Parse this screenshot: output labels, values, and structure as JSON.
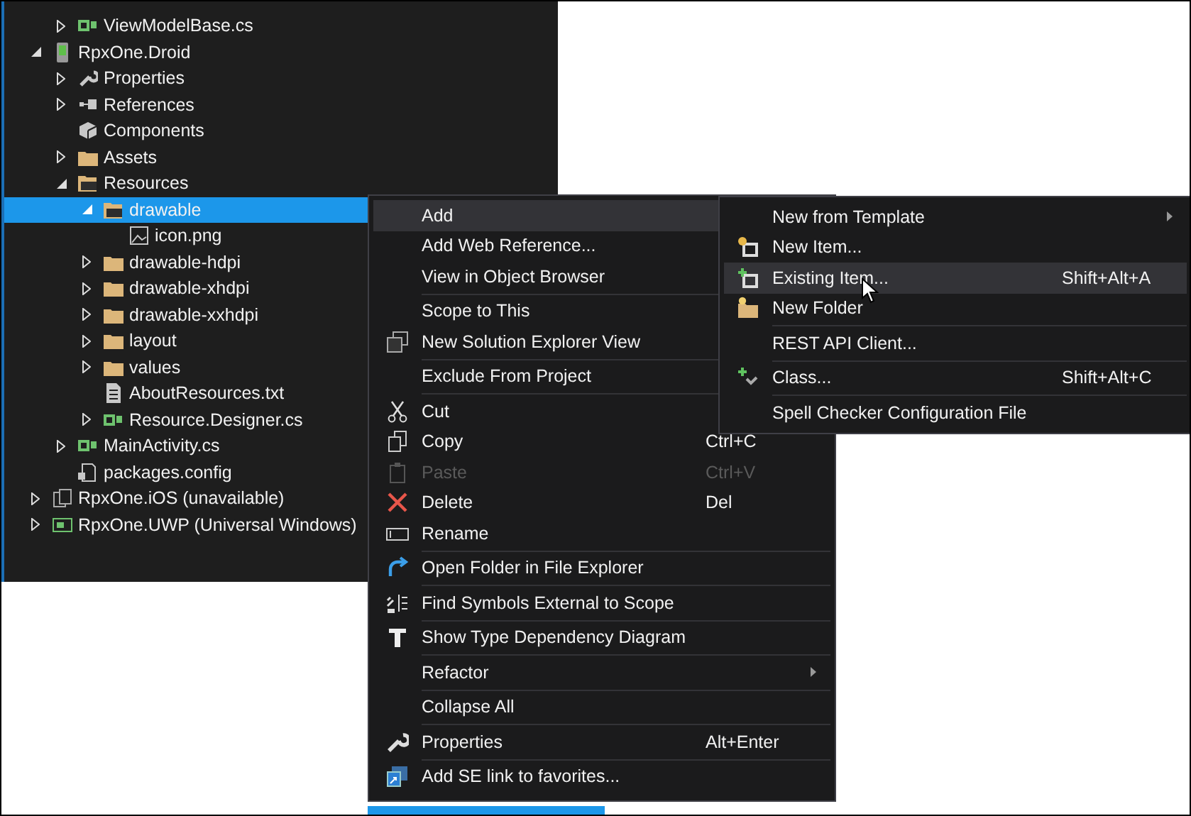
{
  "tree": {
    "cut_off_items": [
      {
        "label": "ViewModelBase.cs",
        "kind": "csharp",
        "expanded": false,
        "selected": false
      }
    ],
    "items": [
      {
        "label": "RpxOne.Droid",
        "kind": "android",
        "expanded": true,
        "selected": false,
        "children": [
          {
            "label": "Properties",
            "kind": "wrench",
            "expanded": false,
            "selected": false
          },
          {
            "label": "References",
            "kind": "references",
            "expanded": false,
            "selected": false
          },
          {
            "label": "Components",
            "kind": "component",
            "selected": false
          },
          {
            "label": "Assets",
            "kind": "folder",
            "expanded": false,
            "selected": false
          },
          {
            "label": "Resources",
            "kind": "folder",
            "expanded": true,
            "selected": false,
            "children": [
              {
                "label": "drawable",
                "kind": "folder",
                "expanded": true,
                "selected": true,
                "children": [
                  {
                    "label": "icon.png",
                    "kind": "image",
                    "selected": false
                  }
                ]
              },
              {
                "label": "drawable-hdpi",
                "kind": "folder",
                "expanded": false,
                "selected": false
              },
              {
                "label": "drawable-xhdpi",
                "kind": "folder",
                "expanded": false,
                "selected": false
              },
              {
                "label": "drawable-xxhdpi",
                "kind": "folder",
                "expanded": false,
                "selected": false
              },
              {
                "label": "layout",
                "kind": "folder",
                "expanded": false,
                "selected": false
              },
              {
                "label": "values",
                "kind": "folder",
                "expanded": false,
                "selected": false
              },
              {
                "label": "AboutResources.txt",
                "kind": "textfile",
                "selected": false
              },
              {
                "label": "Resource.Designer.cs",
                "kind": "csharp",
                "expanded": false,
                "selected": false
              }
            ]
          },
          {
            "label": "MainActivity.cs",
            "kind": "csharp",
            "expanded": false,
            "selected": false
          },
          {
            "label": "packages.config",
            "kind": "config",
            "selected": false
          }
        ]
      },
      {
        "label": "RpxOne.iOS (unavailable)",
        "kind": "ios",
        "expanded": false,
        "selected": false
      },
      {
        "label": "RpxOne.UWP (Universal Windows)",
        "kind": "uwp",
        "expanded": false,
        "selected": false
      }
    ]
  },
  "context_menu": [
    {
      "kind": "plain",
      "label": "Add",
      "highlighted": true,
      "submenu": true
    },
    {
      "kind": "plain",
      "label": "Add Web Reference..."
    },
    {
      "kind": "plain",
      "label": "View in Object Browser"
    },
    {
      "kind": "separator"
    },
    {
      "kind": "plain",
      "label": "Scope to This"
    },
    {
      "kind": "windows",
      "label": "New Solution Explorer View"
    },
    {
      "kind": "separator"
    },
    {
      "kind": "plain",
      "label": "Exclude From Project"
    },
    {
      "kind": "separator"
    },
    {
      "kind": "scissors",
      "label": "Cut"
    },
    {
      "kind": "copy",
      "label": "Copy",
      "shortcut": "Ctrl+C"
    },
    {
      "kind": "paste",
      "label": "Paste",
      "shortcut": "Ctrl+V",
      "disabled": true
    },
    {
      "kind": "delete",
      "label": "Delete",
      "shortcut": "Del"
    },
    {
      "kind": "rename",
      "label": "Rename"
    },
    {
      "kind": "separator"
    },
    {
      "kind": "openfolder",
      "label": "Open Folder in File Explorer"
    },
    {
      "kind": "separator"
    },
    {
      "kind": "symbols",
      "label": "Find Symbols External to Scope"
    },
    {
      "kind": "separator"
    },
    {
      "kind": "type",
      "label": "Show Type Dependency Diagram"
    },
    {
      "kind": "separator"
    },
    {
      "kind": "plain",
      "label": "Refactor",
      "submenu": true
    },
    {
      "kind": "separator"
    },
    {
      "kind": "plain",
      "label": "Collapse All"
    },
    {
      "kind": "separator"
    },
    {
      "kind": "wrench",
      "label": "Properties",
      "shortcut": "Alt+Enter"
    },
    {
      "kind": "separator"
    },
    {
      "kind": "link",
      "label": "Add SE link to favorites..."
    }
  ],
  "add_submenu": [
    {
      "kind": "plain",
      "label": "New from Template",
      "submenu": true
    },
    {
      "kind": "newitem",
      "label": "New Item..."
    },
    {
      "kind": "existingitem",
      "label": "Existing Item...",
      "shortcut": "Shift+Alt+A",
      "highlighted": true
    },
    {
      "kind": "newfolder",
      "label": "New Folder"
    },
    {
      "kind": "separator"
    },
    {
      "kind": "plain",
      "label": "REST API Client..."
    },
    {
      "kind": "separator"
    },
    {
      "kind": "class",
      "label": "Class...",
      "shortcut": "Shift+Alt+C"
    },
    {
      "kind": "separator"
    },
    {
      "kind": "plain",
      "label": "Spell Checker Configuration File"
    }
  ]
}
